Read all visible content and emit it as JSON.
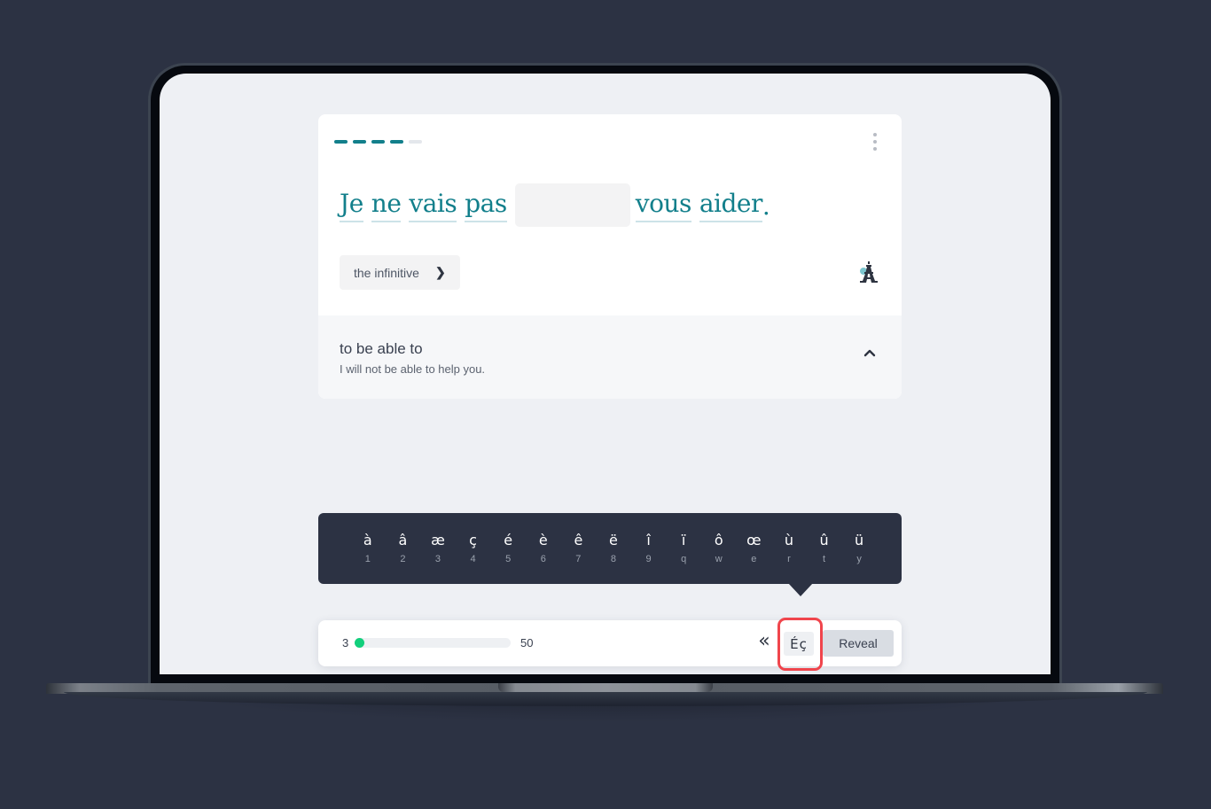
{
  "exercise": {
    "progress_steps_total": 5,
    "progress_steps_done": 4,
    "menu_icon": "more-vertical-icon",
    "sentence": {
      "before_words": [
        "Je",
        "ne",
        "vais",
        "pas"
      ],
      "blank_value": "",
      "after_words": [
        "vous",
        "aider"
      ],
      "end_punctuation": "."
    },
    "hint": {
      "label": "the infinitive",
      "icon": "chevron-right-icon",
      "chevron_glyph": "❯"
    },
    "culture_icon": "eiffel-tower-icon",
    "accent_color": "#127f8b"
  },
  "translation": {
    "title": "to be able to",
    "sentence": "I will not be able to help you.",
    "toggle_icon": "chevron-up-icon"
  },
  "accent_keyboard": {
    "keys": [
      {
        "char": "à",
        "shortcut": "1"
      },
      {
        "char": "â",
        "shortcut": "2"
      },
      {
        "char": "æ",
        "shortcut": "3"
      },
      {
        "char": "ç",
        "shortcut": "4"
      },
      {
        "char": "é",
        "shortcut": "5"
      },
      {
        "char": "è",
        "shortcut": "6"
      },
      {
        "char": "ê",
        "shortcut": "7"
      },
      {
        "char": "ë",
        "shortcut": "8"
      },
      {
        "char": "î",
        "shortcut": "9"
      },
      {
        "char": "ï",
        "shortcut": "q"
      },
      {
        "char": "ô",
        "shortcut": "w"
      },
      {
        "char": "œ",
        "shortcut": "e"
      },
      {
        "char": "ù",
        "shortcut": "r"
      },
      {
        "char": "û",
        "shortcut": "t"
      },
      {
        "char": "ü",
        "shortcut": "y"
      }
    ]
  },
  "footer": {
    "count_done": "3",
    "count_total": "50",
    "progress_fraction": 0.06,
    "progress_color": "#12cf7c",
    "rewind_glyph": "«",
    "rewind_icon": "double-chevron-left-icon",
    "accent_toggle_label": "Éç",
    "reveal_label": "Reveal",
    "highlight_color": "#f0454c"
  }
}
